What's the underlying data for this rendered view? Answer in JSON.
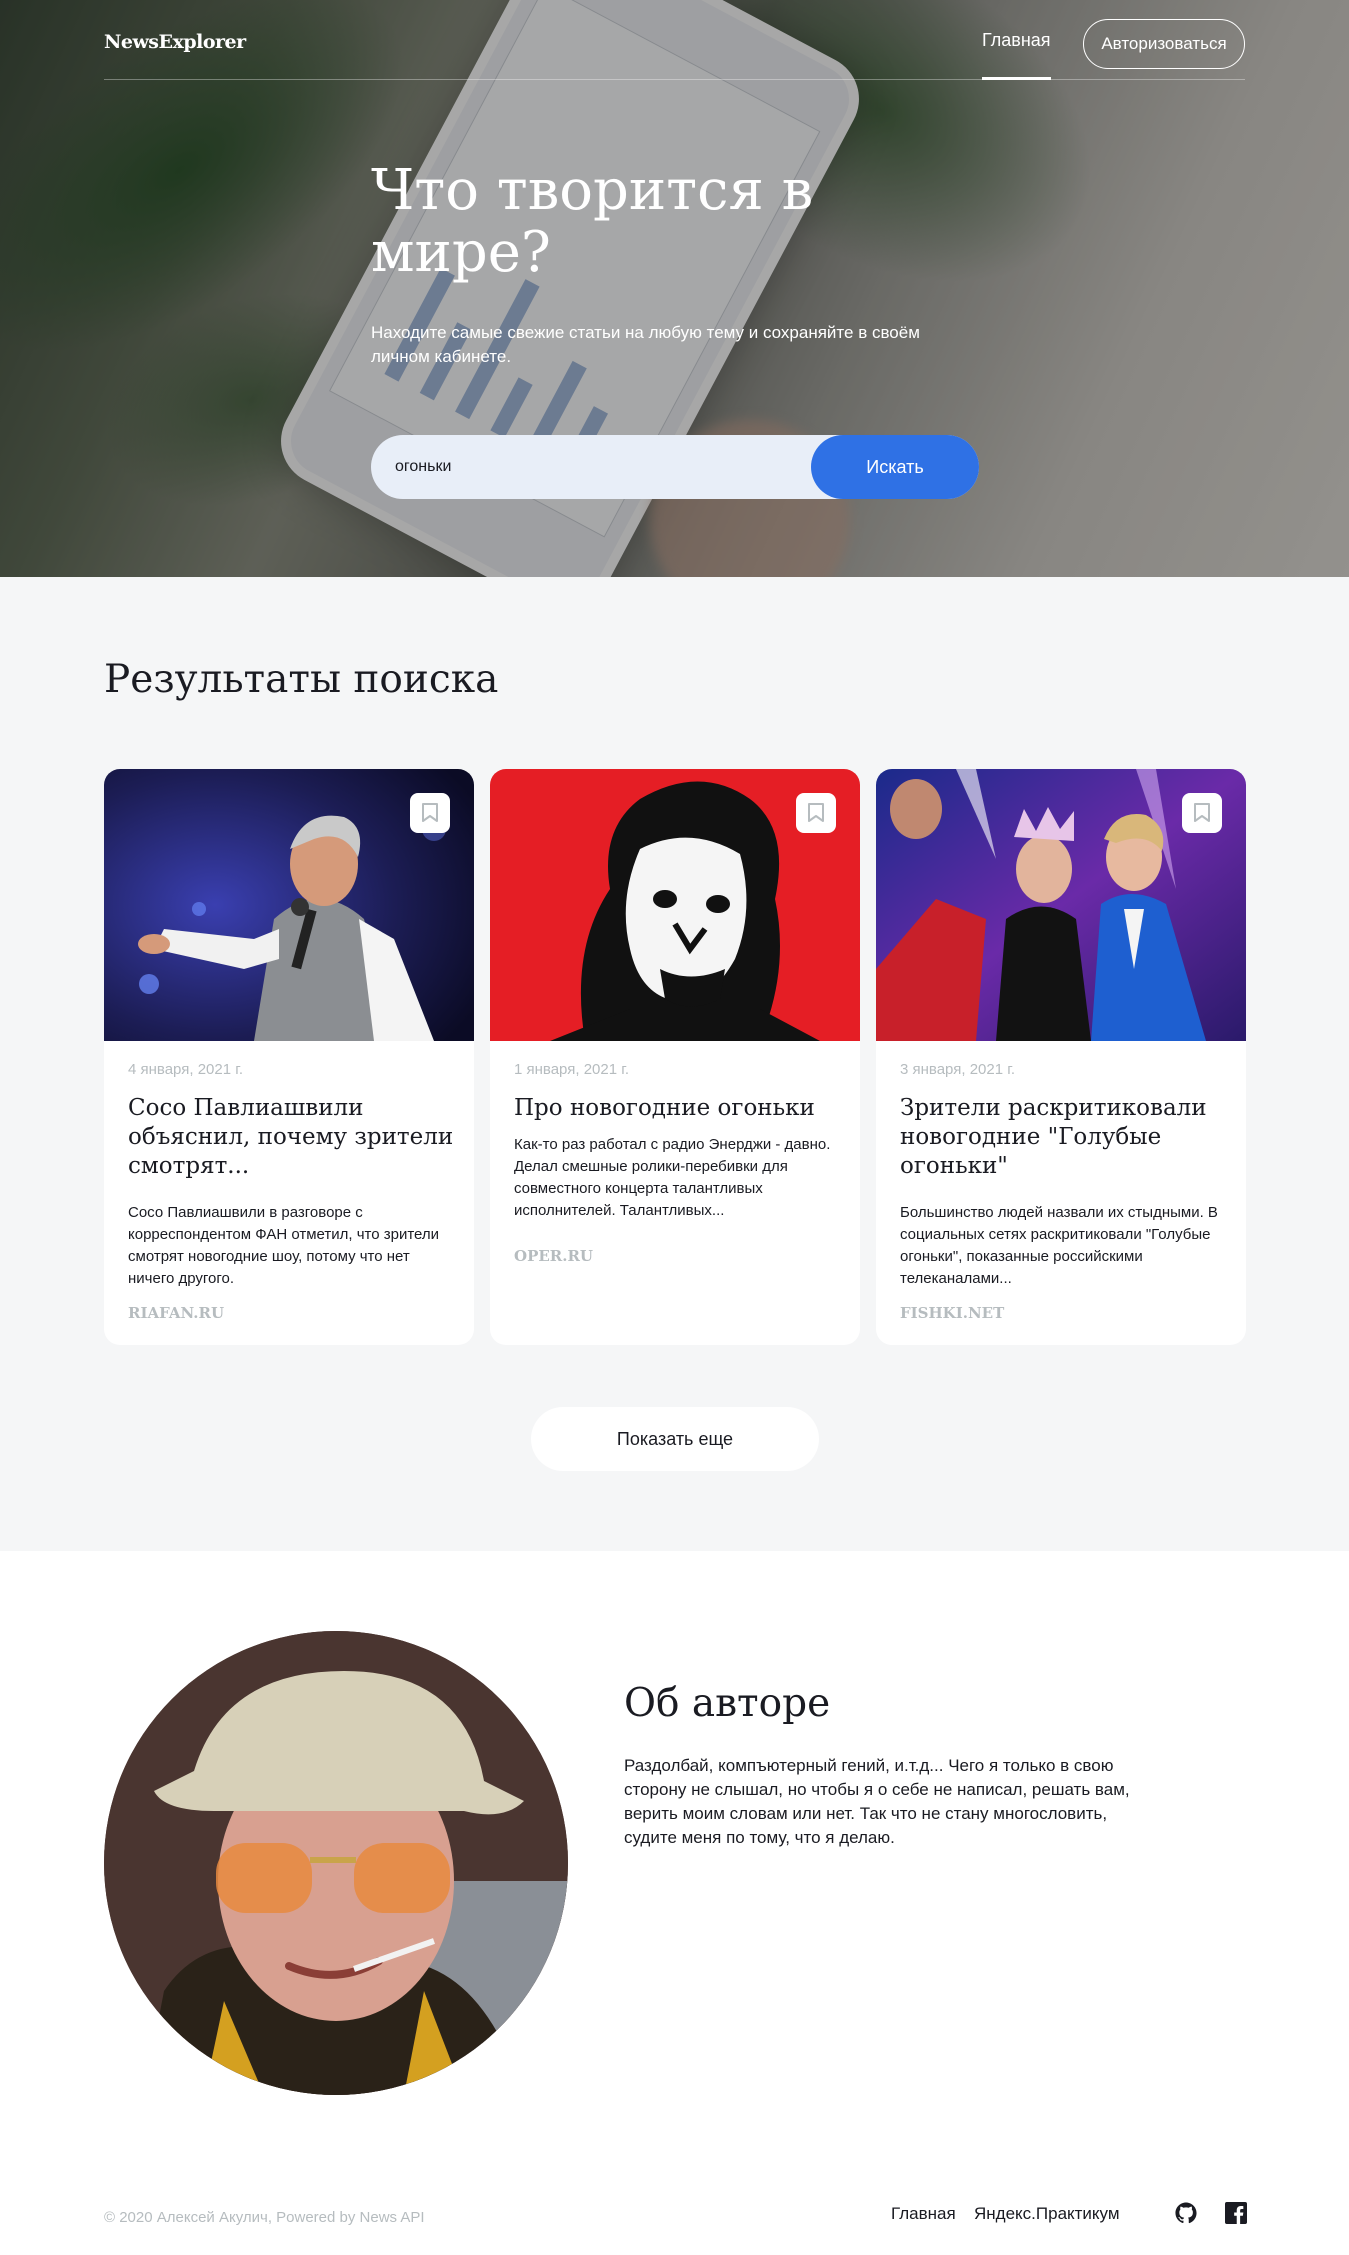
{
  "header": {
    "logo": "NewsExplorer",
    "nav_home": "Главная",
    "auth_button": "Авторизоваться"
  },
  "hero": {
    "title": "Что творится в мире?",
    "subtitle": "Находите самые свежие статьи на любую тему и сохраняйте в своём личном кабинете.",
    "search_value": "огоньки",
    "search_button": "Искать"
  },
  "results": {
    "title": "Результаты поиска",
    "cards": [
      {
        "date": "4 января, 2021 г.",
        "title": "Сосо Павлиашвили объяснил, почему зрители смотрят...",
        "text": "Сосо Павлиашвили в разговоре с корреспондентом ФАН отметил, что зрители смотрят новогодние шоу, потому что нет ничего другого.",
        "source": "RIAFAN.RU"
      },
      {
        "date": "1 января, 2021 г.",
        "title": "Про новогодние огоньки",
        "text": "Как-то раз работал с радио Энерджи - давно. Делал смешные ролики-перебивки для совместного концерта талантливых исполнителей. Талантливых...",
        "source": "OPER.RU"
      },
      {
        "date": "3 января, 2021 г.",
        "title": "Зрители раскритиковали новогодние \"Голубые огоньки\"",
        "text": "Большинство людей назвали их стыдными. В социальных сетях раскритиковали \"Голубые огоньки\", показанные российскими телеканалами...",
        "source": "FISHKI.NET"
      }
    ],
    "more_button": "Показать еще"
  },
  "about": {
    "title": "Об авторе",
    "text": "Раздолбай, компъютерный гений, и.т.д... Чего я только в свою сторону не слышал, но чтобы я о себе не написал, решать вам, верить моим словам или нет. Так что не стану многословить, судите меня по тому, что я делаю."
  },
  "footer": {
    "copyright": "© 2020 Алексей Акулич, Powered by News API",
    "link_home": "Главная",
    "link_praktikum": "Яндекс.Практикум",
    "icons": [
      "github-icon",
      "facebook-icon"
    ]
  },
  "colors": {
    "accent": "#2f71e5",
    "text": "#1a1b22",
    "muted": "#b6bcbf",
    "section_bg": "#f5f6f7",
    "search_bg": "#e8eef8"
  }
}
